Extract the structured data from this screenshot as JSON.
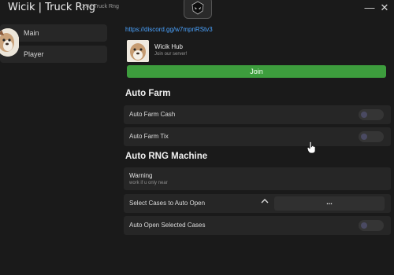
{
  "window": {
    "title": "Wicik | Truck Rng",
    "subtitle": "v1.0 | Truck Rng",
    "minimize_glyph": "—",
    "close_glyph": "✕"
  },
  "sidebar": {
    "items": [
      {
        "label": "Main"
      },
      {
        "label": "Player"
      }
    ]
  },
  "main": {
    "discord_link": "https://discord.gg/w7mpnRStv3",
    "hub": {
      "name": "Wicik Hub",
      "description": "Join our server!",
      "join_label": "Join"
    },
    "sections": {
      "auto_farm": {
        "title": "Auto Farm",
        "rows": [
          {
            "label": "Auto Farm Cash",
            "toggle": false
          },
          {
            "label": "Auto Farm Tix",
            "toggle": false
          }
        ]
      },
      "auto_rng": {
        "title": "Auto RNG Machine",
        "warning_title": "Warning",
        "warning_text": "work if u only near",
        "select_label": "Select Cases to Auto Open",
        "select_value": "...",
        "open_label": "Auto Open Selected Cases",
        "open_toggle": false
      }
    }
  },
  "colors": {
    "background": "#1a1a1a",
    "row": "#262626",
    "accent_green": "#3d9d3d",
    "link_blue": "#4aa3ff"
  }
}
